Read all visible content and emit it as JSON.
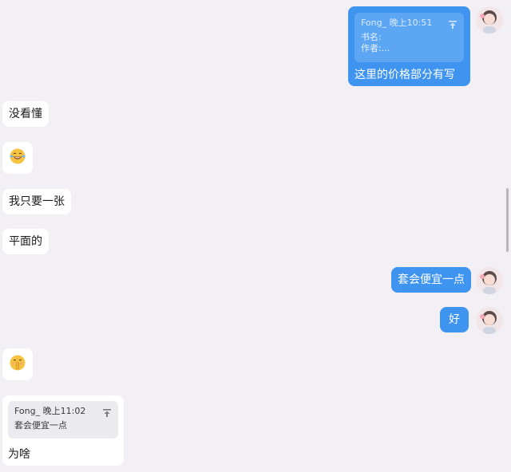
{
  "messages": {
    "quote_sent": {
      "sender_time": "Fong_ 晚上10:51",
      "line1": "书名:",
      "line2": "作者:...",
      "text": "这里的价格部分有写"
    },
    "m1": {
      "text": "没看懂"
    },
    "m2": {
      "emoji": "laughing-tears-emoji"
    },
    "m3": {
      "text": "我只要一张"
    },
    "m4": {
      "text": "平面的"
    },
    "m5": {
      "text": "套会便宜一点"
    },
    "m6": {
      "text": "好"
    },
    "m7": {
      "emoji": "hushing-face-emoji"
    },
    "quote_received": {
      "sender_time": "Fong_ 晚上11:02",
      "line1": "套会便宜一点",
      "text": "为啥"
    }
  },
  "icons": {
    "jump_to_original": "jump-to-top-icon",
    "avatar": "user-avatar"
  },
  "colors": {
    "background": "#f2f0f4",
    "sent_bubble": "#3f94f0",
    "received_bubble": "#ffffff",
    "quote_sent_card": "#5da6f3",
    "quote_received_card": "#ecebef"
  }
}
